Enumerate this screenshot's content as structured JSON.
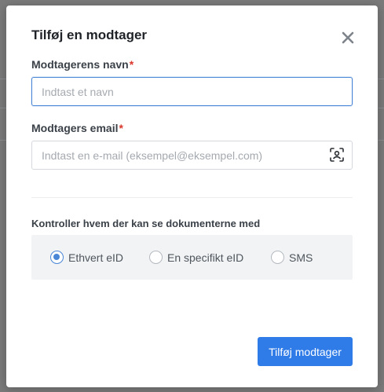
{
  "modal": {
    "title": "Tilføj en modtager",
    "close_icon": "close-icon"
  },
  "fields": {
    "name": {
      "label": "Modtagerens navn",
      "required_marker": "*",
      "placeholder": "Indtast et navn",
      "value": ""
    },
    "email": {
      "label": "Modtagers email",
      "required_marker": "*",
      "placeholder": "Indtast en e-mail (eksempel@eksempel.com)",
      "value": "",
      "icon": "contact-scan-icon"
    }
  },
  "access_control": {
    "label": "Kontroller hvem der kan se dokumenterne med",
    "options": [
      {
        "label": "Ethvert eID",
        "selected": true
      },
      {
        "label": "En specifikt eID",
        "selected": false
      },
      {
        "label": "SMS",
        "selected": false
      }
    ]
  },
  "actions": {
    "submit_label": "Tilføj modtager"
  },
  "colors": {
    "accent": "#2f7be8",
    "required": "#d9372b",
    "focus_border": "#4a86d6"
  }
}
